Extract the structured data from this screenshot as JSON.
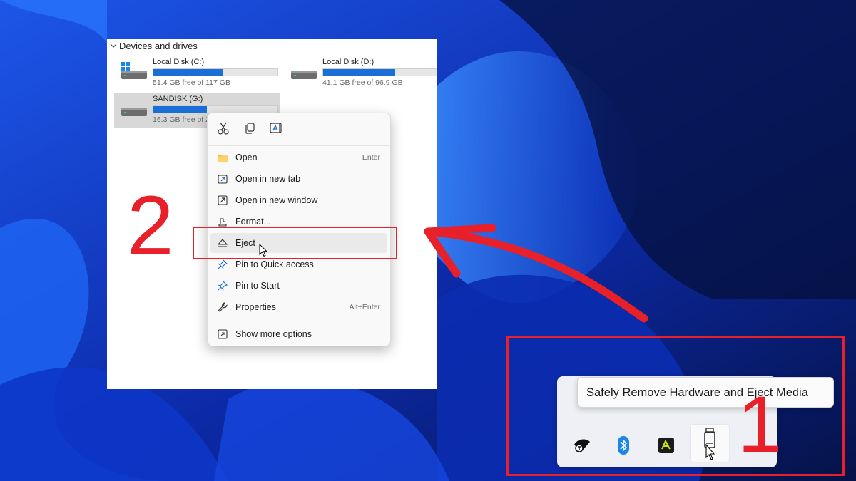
{
  "colors": {
    "accent": "#1a6fd6",
    "annotation": "#e8202a",
    "wallpaper": "#0a1a6e"
  },
  "explorer": {
    "section_title": "Devices and drives",
    "drives": [
      {
        "name": "Local Disk (C:)",
        "free_text": "51.4 GB free of 117 GB",
        "used_fraction": 0.56,
        "icon": "windows-drive-icon"
      },
      {
        "name": "Local Disk (D:)",
        "free_text": "41.1 GB free of 96.9 GB",
        "used_fraction": 0.58,
        "icon": "drive-icon"
      },
      {
        "name": "SANDISK (G:)",
        "free_text": "16.3 GB free of 2",
        "used_fraction": 0.43,
        "icon": "usb-drive-icon"
      }
    ]
  },
  "context_menu": {
    "quick_actions": [
      "cut-icon",
      "copy-icon",
      "rename-icon"
    ],
    "items": [
      {
        "label": "Open",
        "shortcut": "Enter",
        "icon": "folder-icon"
      },
      {
        "label": "Open in new tab",
        "shortcut": "",
        "icon": "new-tab-icon"
      },
      {
        "label": "Open in new window",
        "shortcut": "",
        "icon": "new-window-icon"
      },
      {
        "label": "Format...",
        "shortcut": "",
        "icon": "format-icon"
      },
      {
        "label": "Eject",
        "shortcut": "",
        "icon": "eject-icon"
      },
      {
        "label": "Pin to Quick access",
        "shortcut": "",
        "icon": "pin-icon"
      },
      {
        "label": "Pin to Start",
        "shortcut": "",
        "icon": "pin-icon"
      },
      {
        "label": "Properties",
        "shortcut": "Alt+Enter",
        "icon": "wrench-icon"
      },
      {
        "label": "Show more options",
        "shortcut": "",
        "icon": "more-options-icon"
      }
    ]
  },
  "annotations": {
    "step1": "1",
    "step2": "2"
  },
  "tray": {
    "tooltip": "Safely Remove Hardware and Eject Media",
    "icons": [
      "network-drive-icon",
      "bluetooth-icon",
      "app-icon",
      "usb-eject-icon"
    ]
  }
}
